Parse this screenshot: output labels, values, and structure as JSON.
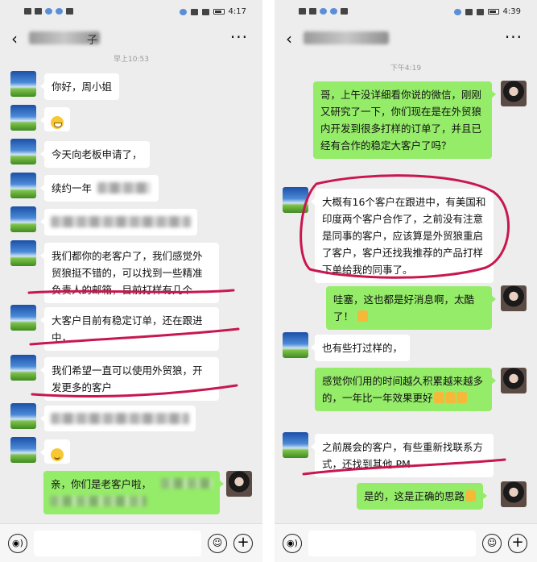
{
  "left": {
    "status_time": "4:17",
    "timestamp": "早上10:53",
    "contact_suffix": "子",
    "messages": [
      {
        "text": "你好，周小姐"
      },
      {
        "text": ""
      },
      {
        "text": "今天向老板申请了，"
      },
      {
        "text": "续约一年"
      },
      {
        "text": "我们都你的老客户了，我们感觉外贸狼挺不错的，可以找到一些精准负责人的邮箱，目前打样有几个"
      },
      {
        "text": "大客户目前有稳定订单，还在跟进中，"
      },
      {
        "text": "我们希望一直可以使用外贸狼，开发更多的客户"
      },
      {
        "text": "亲，你们是老客户啦，"
      }
    ]
  },
  "right": {
    "status_time": "4:39",
    "timestamp": "下午4:19",
    "messages": [
      {
        "text": "哥，上午没详细看你说的微信，刚刚又研究了一下，你们现在是在外贸狼内开发到很多打样的订单了，并且已经有合作的稳定大客户了吗？"
      },
      {
        "text": "大概有16个客户在跟进中，有美国和印度两个客户合作了，之前没有注意是同事的客户，应该算是外贸狼重启了客户，客户还找我推荐的产品打样下单给我的同事了。"
      },
      {
        "text": "哇塞，这也都是好消息啊，太酷了！"
      },
      {
        "text": "也有些打过样的，"
      },
      {
        "text": "感觉你们用的时间越久积累越来越多的，一年比一年效果更好"
      },
      {
        "text": "之前展会的客户，有些重新找联系方式，还找到其他 PM"
      },
      {
        "text": "是的，这是正确的思路"
      }
    ]
  },
  "icons": {
    "back": "‹",
    "more": "···",
    "voice": "◉)",
    "emoji_btn": "☺",
    "plus": "+"
  },
  "colors": {
    "sent_bubble": "#95ec69",
    "received_bubble": "#ffffff",
    "annotation": "#c8174f"
  }
}
